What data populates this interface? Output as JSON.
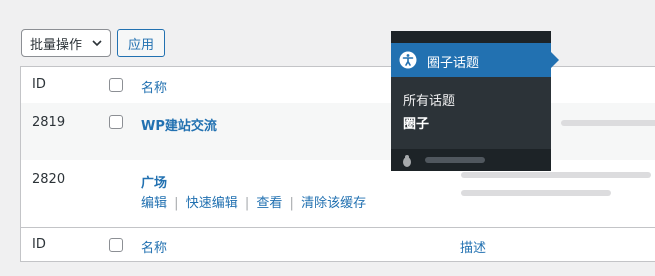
{
  "toolbar": {
    "bulk_actions_label": "批量操作",
    "apply_label": "应用"
  },
  "table": {
    "columns": {
      "id": "ID",
      "name": "名称",
      "description": "描述"
    },
    "rows": [
      {
        "id": "2819",
        "name": "WP建站交流"
      },
      {
        "id": "2820",
        "name": "广场",
        "actions": [
          "编辑",
          "快速编辑",
          "查看",
          "清除该缓存"
        ]
      }
    ],
    "action_separator": "|"
  },
  "admin_menu": {
    "active_item": {
      "label": "圈子话题",
      "icon": "accessibility-icon"
    },
    "submenu": [
      {
        "label": "所有话题",
        "current": false
      },
      {
        "label": "圈子",
        "current": true
      }
    ],
    "next_item_icon": "bug-icon"
  },
  "colors": {
    "link": "#2271b1",
    "menu_bg": "#1d2327",
    "menu_active": "#2271b1",
    "submenu_bg": "#2c3338"
  }
}
